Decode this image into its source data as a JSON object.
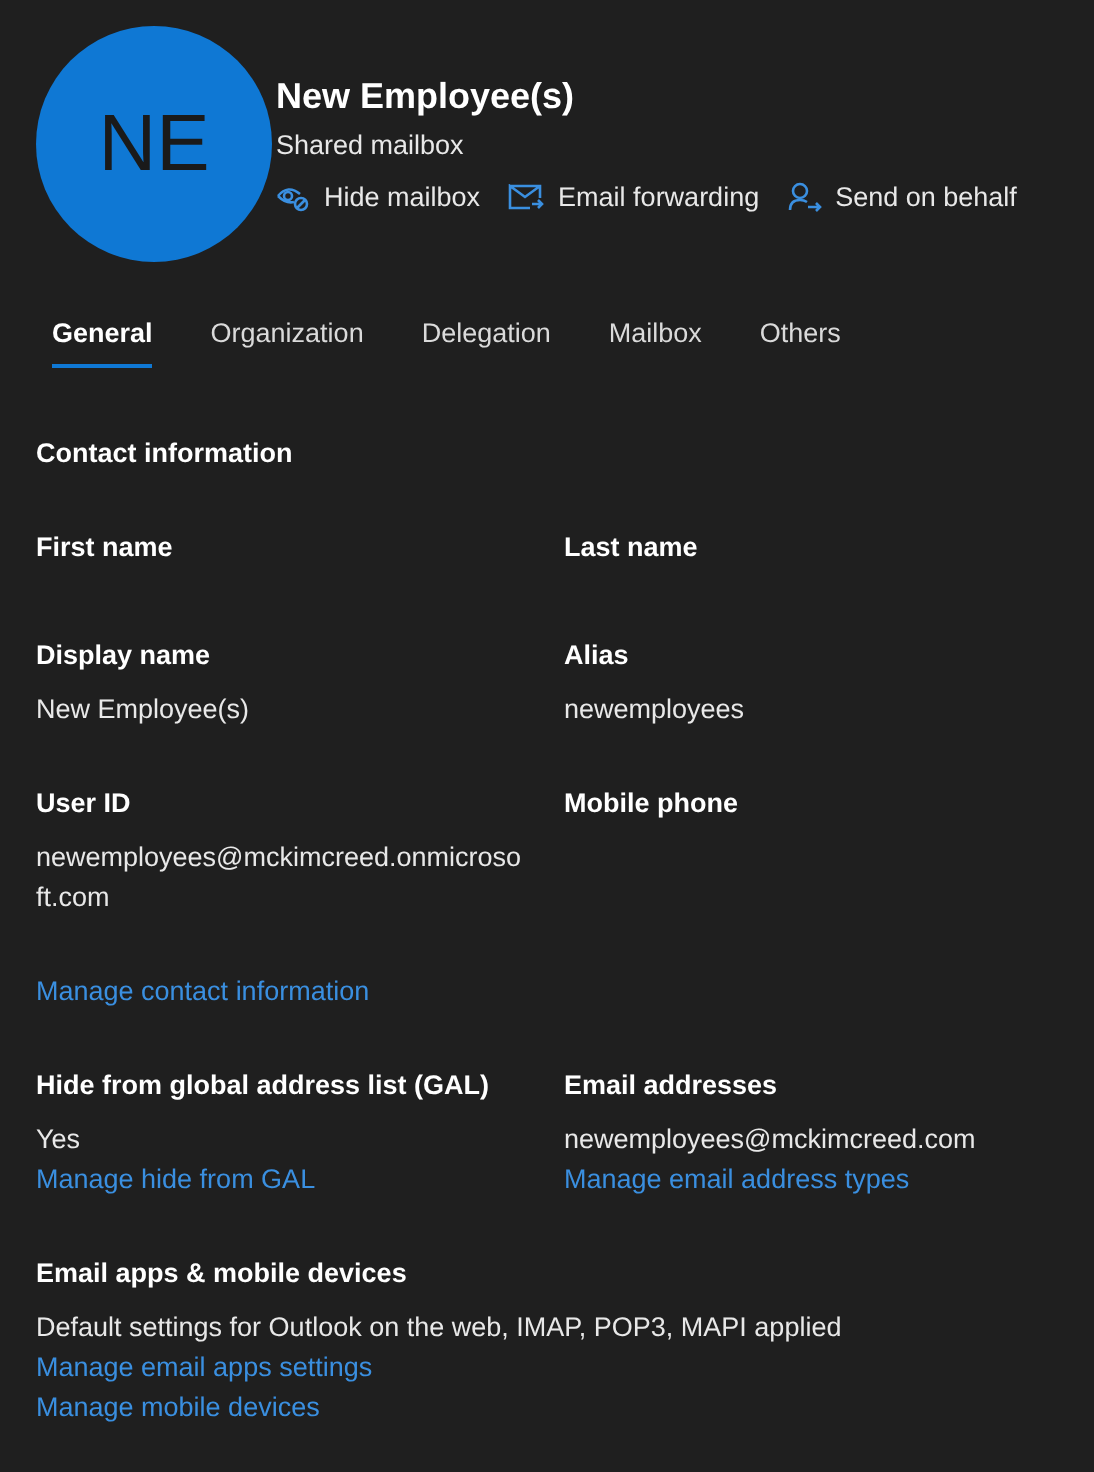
{
  "header": {
    "initials": "NE",
    "name": "New Employee(s)",
    "type": "Shared mailbox",
    "actions": [
      {
        "kind": "hide",
        "label": "Hide mailbox"
      },
      {
        "kind": "forward",
        "label": "Email forwarding"
      },
      {
        "kind": "behalf",
        "label": "Send on behalf"
      }
    ]
  },
  "tabs": [
    {
      "label": "General",
      "selected": true
    },
    {
      "label": "Organization",
      "selected": false
    },
    {
      "label": "Delegation",
      "selected": false
    },
    {
      "label": "Mailbox",
      "selected": false
    },
    {
      "label": "Others",
      "selected": false
    }
  ],
  "section_title": "Contact information",
  "rows": [
    {
      "cells": [
        {
          "label": "First name"
        },
        {
          "label": "Last name"
        }
      ]
    },
    {
      "cells": [
        {
          "label": "Display name",
          "value": "New Employee(s)"
        },
        {
          "label": "Alias",
          "value": "newemployees"
        }
      ]
    },
    {
      "cells": [
        {
          "label": "User ID",
          "value": "newemployees@mckimcreed.onmicrosoft.com"
        },
        {
          "label": "Mobile phone"
        }
      ]
    },
    {
      "cells": [
        {
          "links": [
            "Manage contact information"
          ]
        }
      ]
    },
    {
      "cells": [
        {
          "label": "Hide from global address list (GAL)",
          "value": "Yes",
          "links": [
            "Manage hide from GAL"
          ]
        },
        {
          "label": "Email addresses",
          "value": "newemployees@mckimcreed.com",
          "links": [
            "Manage email address types"
          ]
        }
      ]
    },
    {
      "cells": [
        {
          "label": "Email apps & mobile devices",
          "value": "Default settings for Outlook on the web, IMAP, POP3, MAPI applied",
          "links": [
            "Manage email apps settings",
            "Manage mobile devices"
          ]
        }
      ]
    }
  ]
}
